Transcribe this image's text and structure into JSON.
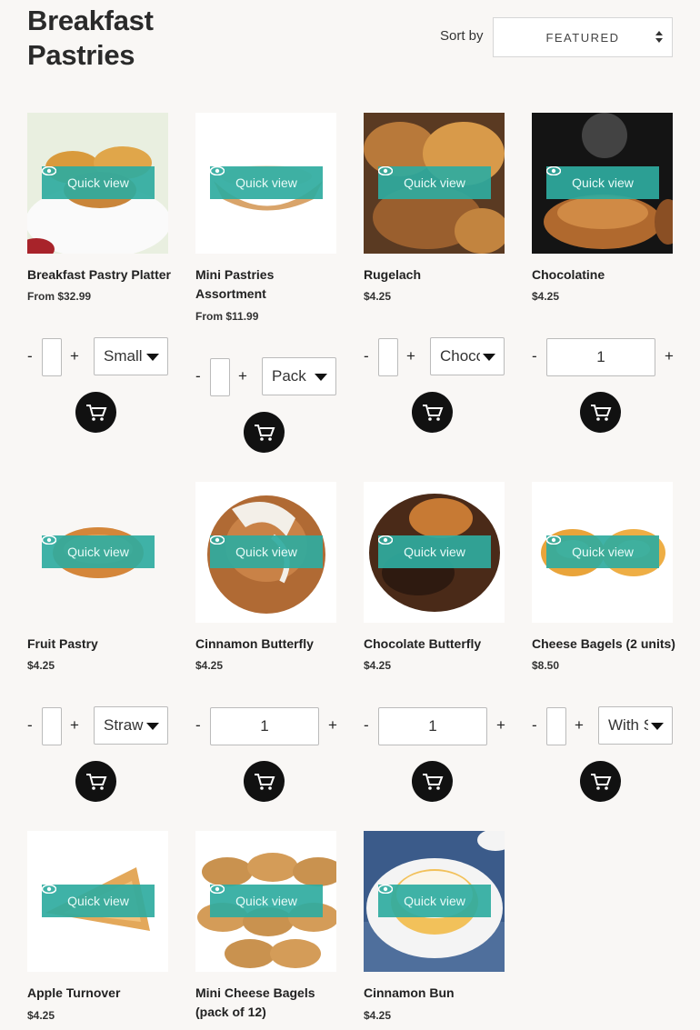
{
  "header": {
    "title": "Breakfast Pastries",
    "sort_label": "Sort by",
    "sort_value": "FEATURED"
  },
  "common": {
    "quick_view": "Quick view",
    "minus": "-",
    "plus": "+"
  },
  "products": [
    {
      "name": "Breakfast Pastry Platter",
      "price": "From $32.99",
      "variant": "Small"
    },
    {
      "name": "Mini Pastries Assortment",
      "price": "From $11.99",
      "variant": "Pack"
    },
    {
      "name": "Rugelach",
      "price": "$4.25",
      "variant": "Choco"
    },
    {
      "name": "Chocolatine",
      "price": "$4.25",
      "quantity": "1"
    },
    {
      "name": "Fruit Pastry",
      "price": "$4.25",
      "variant": "Straw"
    },
    {
      "name": "Cinnamon Butterfly",
      "price": "$4.25",
      "quantity": "1"
    },
    {
      "name": "Chocolate Butterfly",
      "price": "$4.25",
      "quantity": "1"
    },
    {
      "name": "Cheese Bagels (2 units)",
      "price": "$8.50",
      "variant": "With S"
    },
    {
      "name": "Apple Turnover",
      "price": "$4.25"
    },
    {
      "name": "Mini Cheese Bagels (pack of 12)",
      "price": ""
    },
    {
      "name": "Cinnamon Bun",
      "price": "$4.25"
    }
  ],
  "colors": {
    "quick_view_bg": "#2fab9f",
    "cart_button": "#111111",
    "page_bg": "#f9f7f5"
  }
}
